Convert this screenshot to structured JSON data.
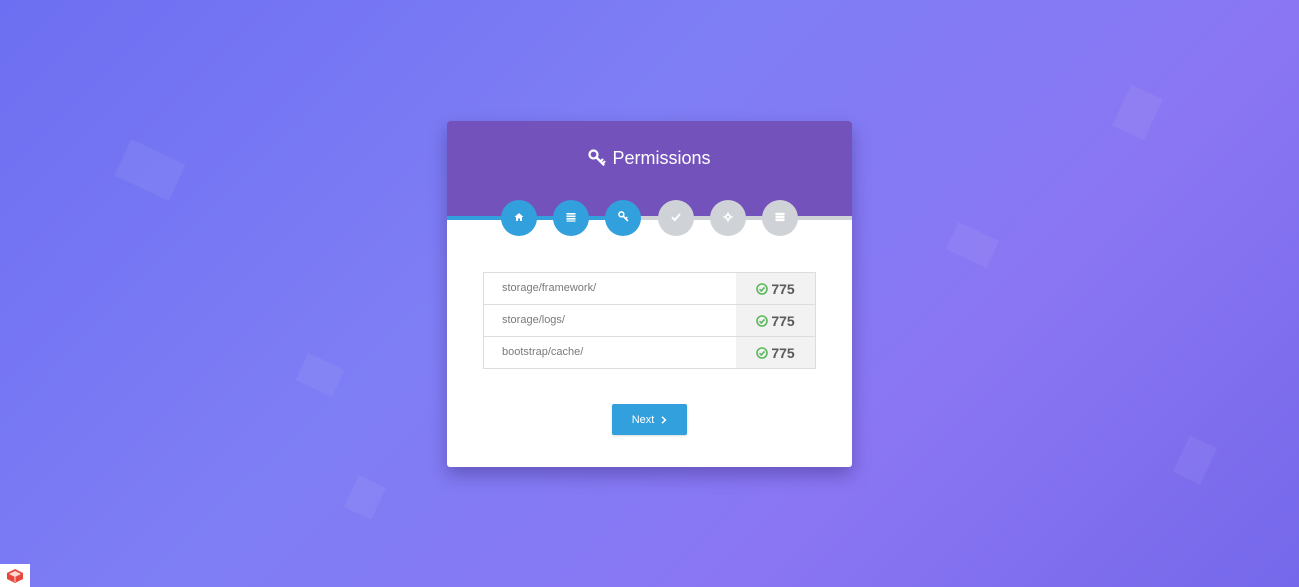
{
  "header": {
    "title": "Permissions",
    "title_icon": "key-icon"
  },
  "steps": [
    {
      "icon": "home-icon",
      "state": "active"
    },
    {
      "icon": "list-icon",
      "state": "active"
    },
    {
      "icon": "key-icon",
      "state": "active"
    },
    {
      "icon": "check-icon",
      "state": "inactive"
    },
    {
      "icon": "gear-icon",
      "state": "inactive"
    },
    {
      "icon": "server-icon",
      "state": "inactive"
    }
  ],
  "permissions": [
    {
      "path": "storage/framework/",
      "value": "775",
      "status_icon": "check-circle-icon"
    },
    {
      "path": "storage/logs/",
      "value": "775",
      "status_icon": "check-circle-icon"
    },
    {
      "path": "bootstrap/cache/",
      "value": "775",
      "status_icon": "check-circle-icon"
    }
  ],
  "next_button": {
    "label": "Next",
    "icon": "chevron-right-icon"
  },
  "colors": {
    "header": "#7452bb",
    "accent": "#32a0dc",
    "inactive_step": "#cfd2d6",
    "success": "#5cb85c"
  }
}
